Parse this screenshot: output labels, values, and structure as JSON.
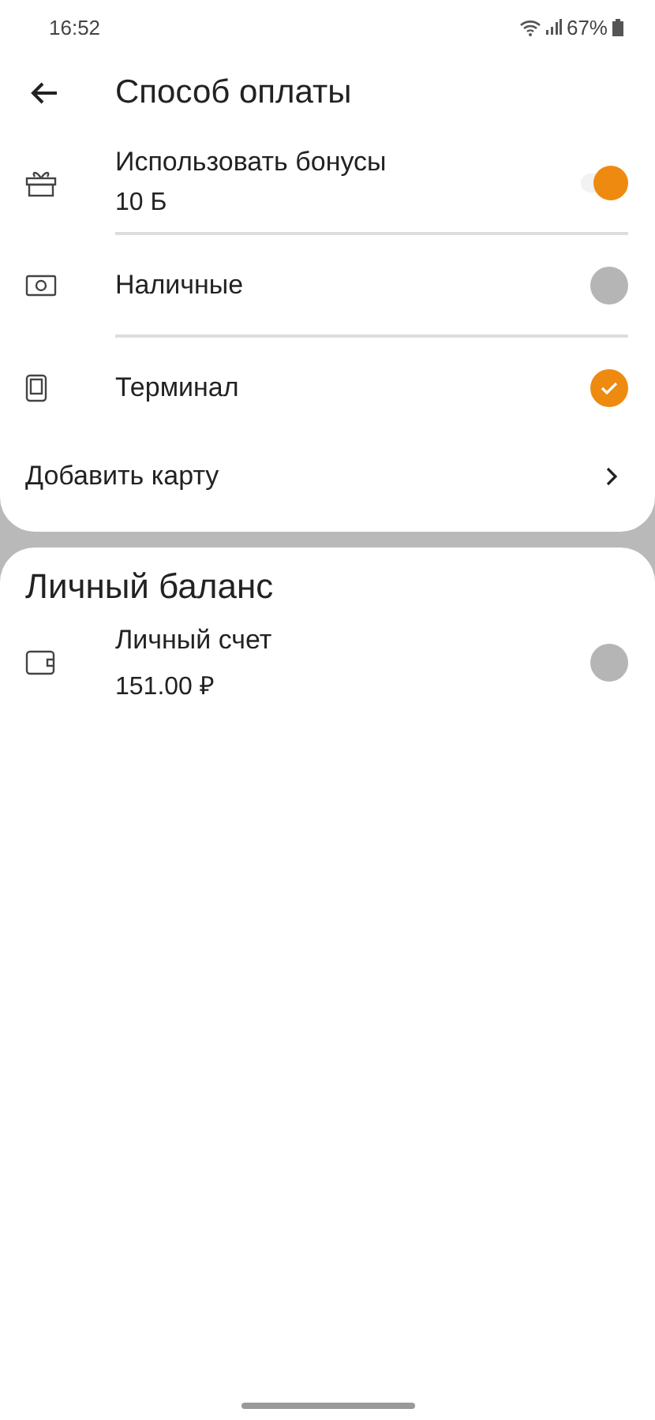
{
  "status_bar": {
    "time": "16:52",
    "battery": "67%"
  },
  "header": {
    "title": "Способ оплаты"
  },
  "payment_methods": [
    {
      "kind": "toggle",
      "label": "Использовать бонусы",
      "sublabel": "10 Б",
      "on": true
    },
    {
      "kind": "radio",
      "label": "Наличные",
      "selected": false
    },
    {
      "kind": "radio",
      "label": "Терминал",
      "selected": true
    }
  ],
  "add_card": {
    "label": "Добавить карту"
  },
  "balance": {
    "title": "Личный баланс",
    "items": [
      {
        "kind": "radio",
        "label": "Личный счет",
        "sublabel": "151.00 ₽",
        "selected": false
      }
    ]
  }
}
